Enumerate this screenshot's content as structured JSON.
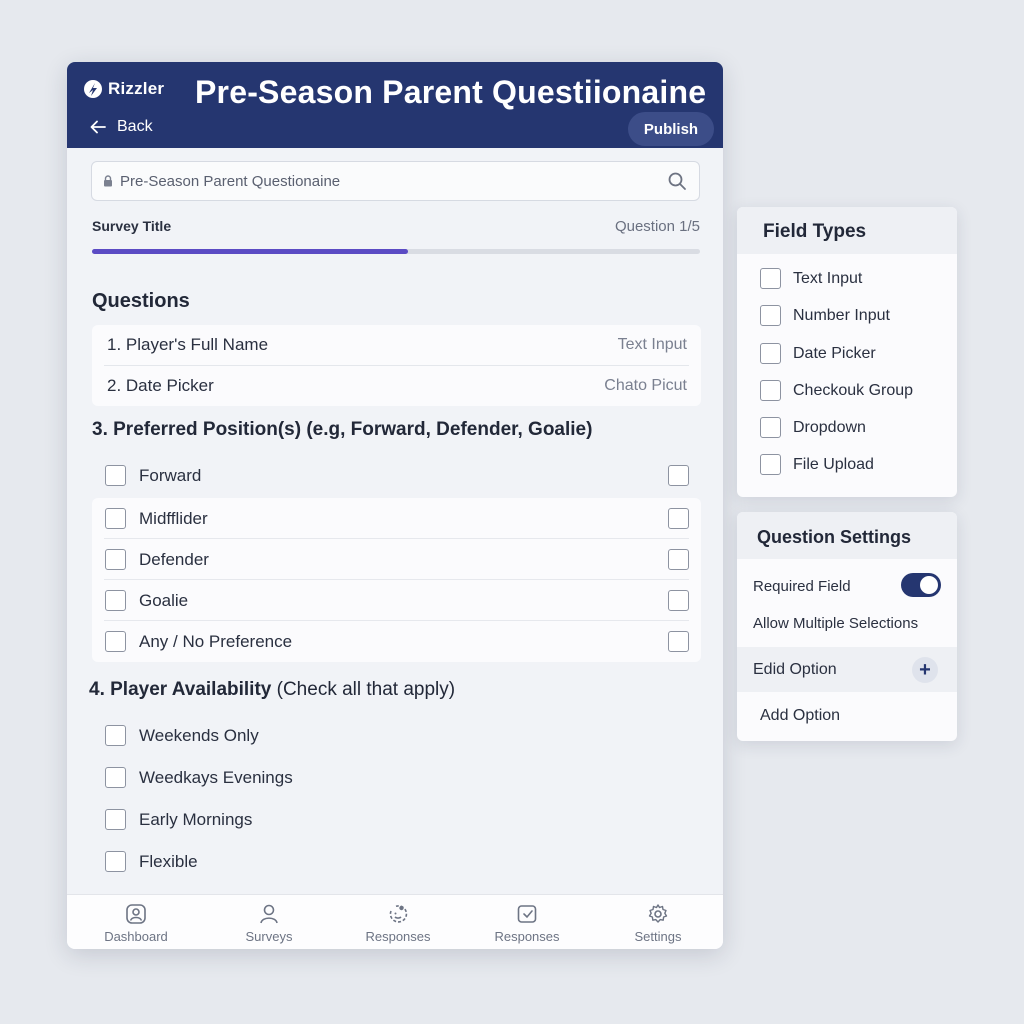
{
  "header": {
    "brand": "Rizzler",
    "title": "Pre-Season Parent Questiionaine",
    "back_label": "Back",
    "publish_label": "Publish",
    "bg_color": "#253670"
  },
  "title_field": {
    "value": "Pre-Season Parent Questionaine",
    "label": "Survey Title",
    "counter": "Question 1/5",
    "progress": 0.52
  },
  "questions": {
    "heading": "Questions",
    "items": [
      {
        "text": "1.  Player's Full Name",
        "type": "Text Input"
      },
      {
        "text": "2.  Date Picker",
        "type": "Chato Picut"
      }
    ]
  },
  "q3": {
    "title": "3. Preferred Position(s) (e.g, Forward, Defender, Goalie)",
    "options": [
      "Forward",
      "Midfflider",
      "Defender",
      "Goalie",
      "Any / No Preference"
    ]
  },
  "q4": {
    "title_bold": "4. Player Availability",
    "title_rest": " (Check all that apply)",
    "options": [
      "Weekends Only",
      "Weedkays Evenings",
      "Early Mornings",
      "Flexible"
    ]
  },
  "nav": {
    "items": [
      {
        "label": "Dashboard",
        "icon": "dashboard-icon"
      },
      {
        "label": "Surveys",
        "icon": "user-icon"
      },
      {
        "label": "Responses",
        "icon": "responses-icon"
      },
      {
        "label": "Responses",
        "icon": "inbox-icon"
      },
      {
        "label": "Settings",
        "icon": "gear-icon"
      }
    ]
  },
  "field_types": {
    "title": "Field Types",
    "items": [
      "Text Input",
      "Number Input",
      "Date Picker",
      "Checkouk Group",
      "Dropdown",
      "File Upload"
    ]
  },
  "question_settings": {
    "title": "Question Settings",
    "required_label": "Required Field",
    "required_on": true,
    "multiple_label": "Allow Multiple Selections",
    "edit_label": "Edid Option",
    "add_label": "Add Option"
  },
  "colors": {
    "accent": "#253670",
    "progress": "#5b4bc4",
    "background": "#e6e9ee"
  }
}
